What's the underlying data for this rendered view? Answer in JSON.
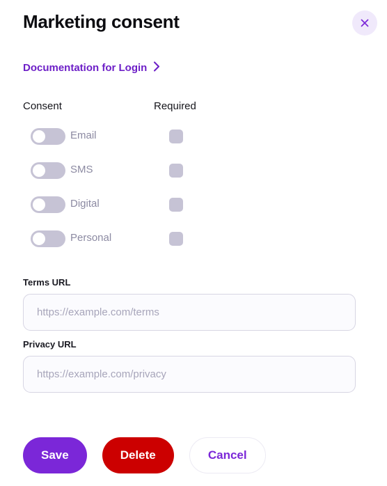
{
  "dialog": {
    "title": "Marketing consent",
    "close_icon": "close-icon"
  },
  "doc_link": {
    "label": "Documentation for Login",
    "chevron_icon": "chevron-right-icon"
  },
  "consent_table": {
    "columns": {
      "consent": "Consent",
      "required": "Required"
    },
    "rows": [
      {
        "label": "Email",
        "enabled": false,
        "required": false
      },
      {
        "label": "SMS",
        "enabled": false,
        "required": false
      },
      {
        "label": "Digital",
        "enabled": false,
        "required": false
      },
      {
        "label": "Personal",
        "enabled": false,
        "required": false
      }
    ]
  },
  "fields": {
    "terms": {
      "label": "Terms URL",
      "value": "",
      "placeholder": "https://example.com/terms"
    },
    "privacy": {
      "label": "Privacy URL",
      "value": "",
      "placeholder": "https://example.com/privacy"
    }
  },
  "footer": {
    "save_label": "Save",
    "delete_label": "Delete",
    "cancel_label": "Cancel"
  },
  "colors": {
    "accent_purple": "#7b27d8",
    "link_purple": "#6d1fc7",
    "danger_red": "#cc0000",
    "toggle_off": "#c6c3d5",
    "close_bg": "#f0e9fb"
  }
}
